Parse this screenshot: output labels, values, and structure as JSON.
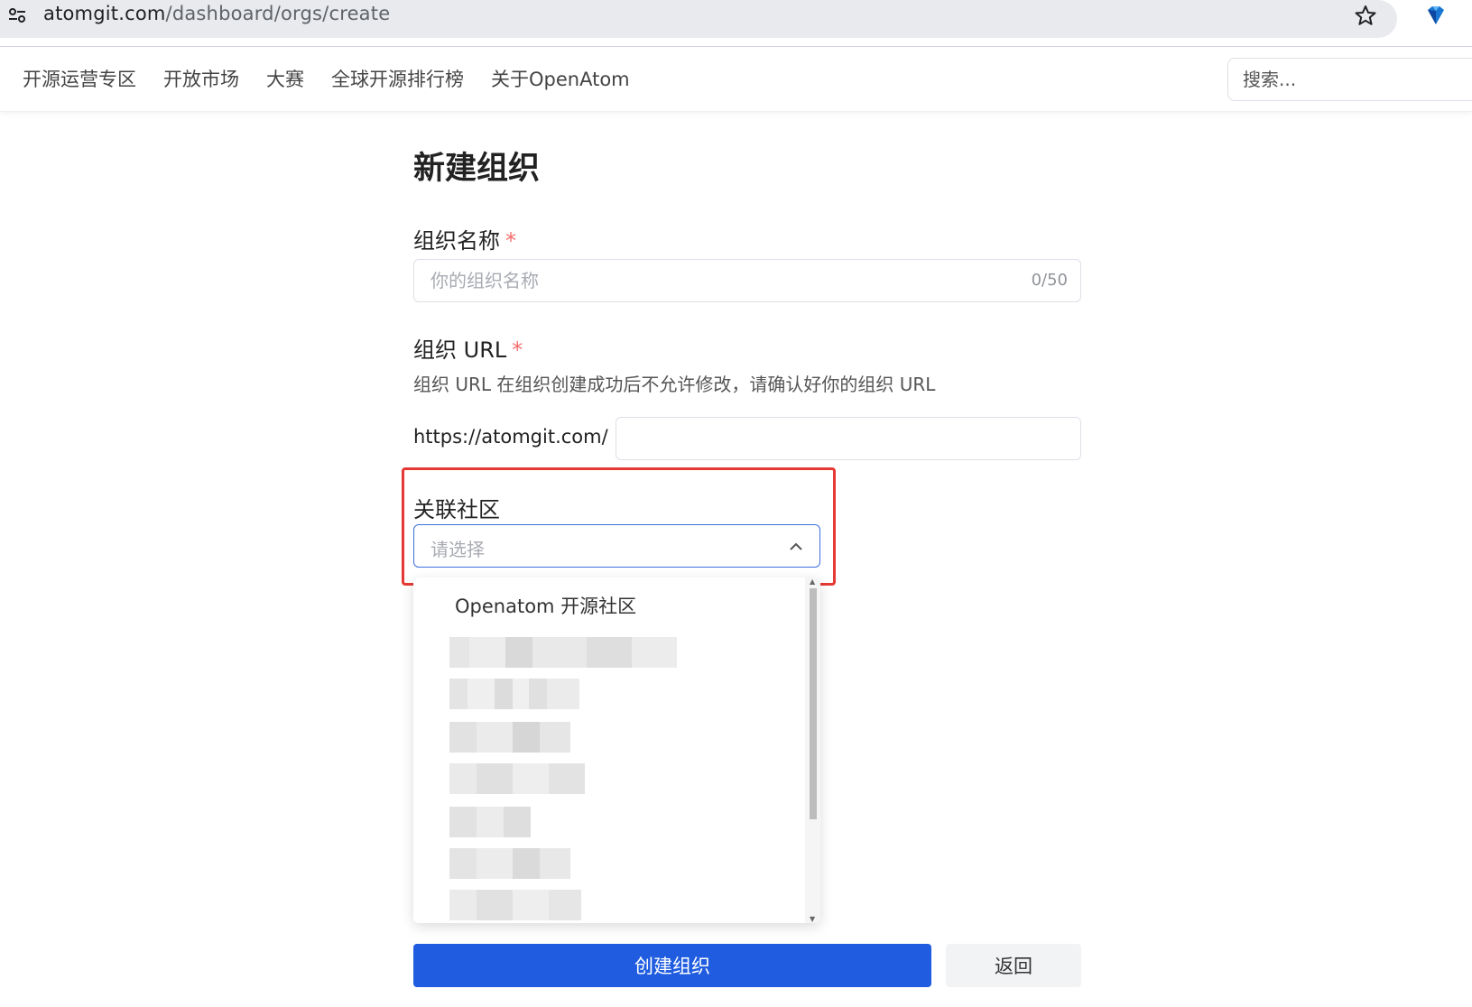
{
  "browser": {
    "url_host": "atomgit.com",
    "url_path": "/dashboard/orgs/create"
  },
  "nav": {
    "items": [
      "开源运营专区",
      "开放市场",
      "大赛",
      "全球开源排行榜",
      "关于OpenAtom"
    ],
    "search_placeholder": "搜索..."
  },
  "form": {
    "title": "新建组织",
    "org_name_label": "组织名称",
    "org_name_placeholder": "你的组织名称",
    "org_name_counter": "0/50",
    "org_url_label": "组织 URL",
    "org_url_help": "组织 URL 在组织创建成功后不允许修改，请确认好你的组织 URL",
    "url_prefix": "https://atomgit.com/",
    "community_label": "关联社区",
    "community_placeholder": "请选择",
    "required_mark": "*",
    "dropdown_first_option": "Openatom 开源社区",
    "create_button": "创建组织",
    "back_button": "返回"
  },
  "colors": {
    "primary": "#1f5ce0",
    "highlight": "#e53935",
    "required": "#f56c6c"
  }
}
